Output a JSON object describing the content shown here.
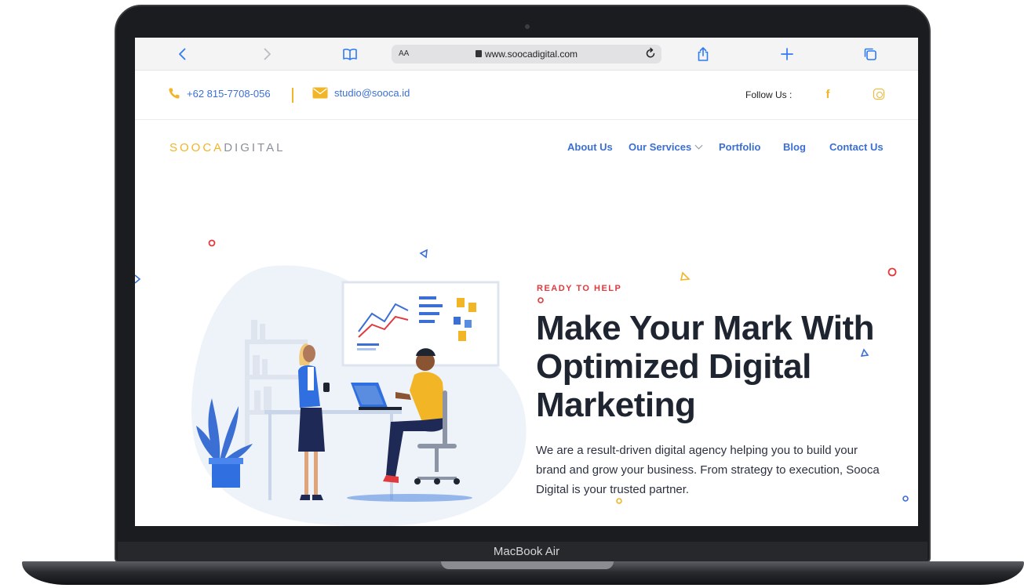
{
  "device": {
    "model_label": "MacBook Air"
  },
  "browser": {
    "text_size_label": "AA",
    "url": "www.soocadigital.com"
  },
  "topbar": {
    "phone": "+62 815-7708-056",
    "email": "studio@sooca.id",
    "follow_label": "Follow Us :"
  },
  "brand": {
    "logo_part1": "SOOCA",
    "logo_part2": "DIGITAL"
  },
  "nav": {
    "items": [
      {
        "label": "About Us"
      },
      {
        "label": "Our Services"
      },
      {
        "label": "Portfolio"
      },
      {
        "label": "Blog"
      },
      {
        "label": "Contact Us"
      }
    ]
  },
  "hero": {
    "eyebrow": "READY TO HELP",
    "headline": "Make Your Mark With Optimized Digital Marketing",
    "description": "We are a result-driven digital agency helping you to build your brand and grow your business. From strategy to execution, Sooca Digital is your trusted partner."
  },
  "colors": {
    "accent_blue": "#3b6fd4",
    "accent_yellow": "#f1b526",
    "accent_red": "#e0393e",
    "heading": "#1e2430"
  },
  "icons": [
    "back-icon",
    "forward-icon",
    "bookmarks-icon",
    "lock-icon",
    "reload-icon",
    "share-icon",
    "new-tab-icon",
    "tabs-icon",
    "phone-icon",
    "mail-icon",
    "facebook-icon",
    "instagram-icon",
    "chevron-down-icon"
  ]
}
